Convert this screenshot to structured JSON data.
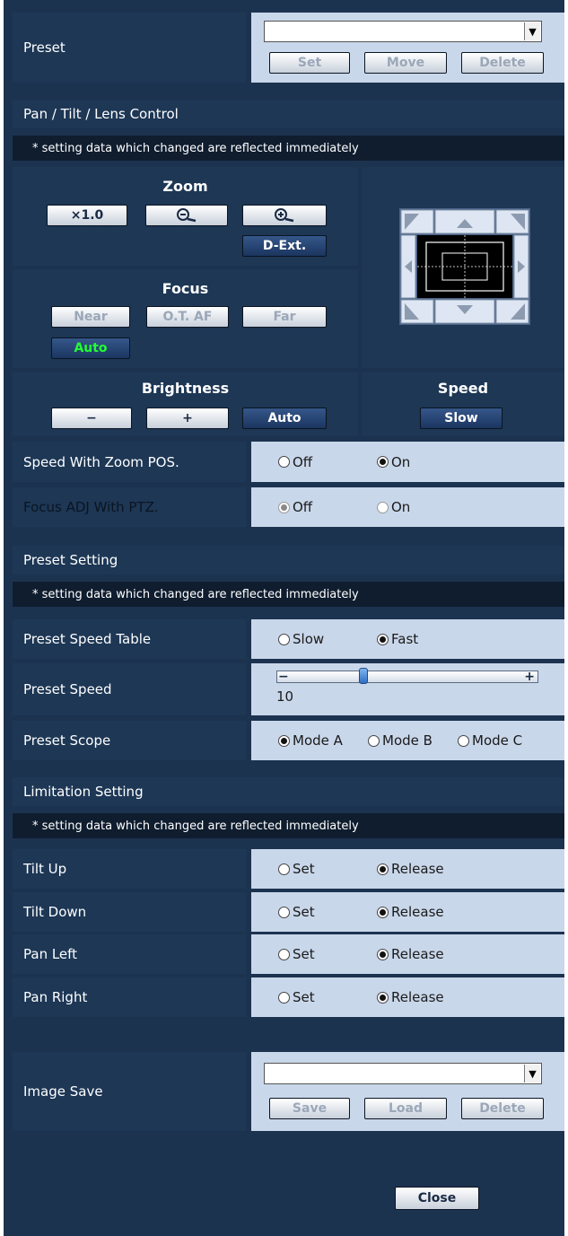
{
  "preset": {
    "label": "Preset",
    "select_value": "",
    "buttons": {
      "set": "Set",
      "move": "Move",
      "delete": "Delete"
    }
  },
  "ptl": {
    "title": "Pan / Tilt / Lens Control",
    "note": "* setting data which changed are reflected immediately",
    "zoom": {
      "title": "Zoom",
      "x1": "×1.0",
      "dext": "D-Ext."
    },
    "focus": {
      "title": "Focus",
      "near": "Near",
      "otaf": "O.T. AF",
      "far": "Far",
      "auto": "Auto"
    },
    "brightness": {
      "title": "Brightness",
      "minus": "−",
      "plus": "+",
      "auto": "Auto"
    },
    "speed": {
      "title": "Speed",
      "value": "Slow"
    },
    "speed_zoom": {
      "label": "Speed With Zoom POS.",
      "off": "Off",
      "on": "On",
      "selected": "On"
    },
    "focus_adj": {
      "label": "Focus ADJ With PTZ.",
      "off": "Off",
      "on": "On",
      "selected": "Off"
    }
  },
  "preset_setting": {
    "title": "Preset Setting",
    "note": "* setting data which changed are reflected immediately",
    "speed_table": {
      "label": "Preset Speed Table",
      "slow": "Slow",
      "fast": "Fast",
      "selected": "Fast"
    },
    "speed": {
      "label": "Preset Speed",
      "value": "10",
      "minus": "−",
      "plus": "+",
      "level": 0.3
    },
    "scope": {
      "label": "Preset Scope",
      "a": "Mode A",
      "b": "Mode B",
      "c": "Mode C",
      "selected": "Mode A"
    }
  },
  "limitation": {
    "title": "Limitation Setting",
    "note": "* setting data which changed are reflected immediately",
    "rows": [
      {
        "label": "Tilt Up",
        "set": "Set",
        "release": "Release"
      },
      {
        "label": "Tilt Down",
        "set": "Set",
        "release": "Release"
      },
      {
        "label": "Pan Left",
        "set": "Set",
        "release": "Release"
      },
      {
        "label": "Pan Right",
        "set": "Set",
        "release": "Release"
      }
    ]
  },
  "image_save": {
    "label": "Image Save",
    "select_value": "",
    "buttons": {
      "save": "Save",
      "load": "Load",
      "delete": "Delete"
    }
  },
  "close": "Close",
  "colors": {
    "bg": "#1c3350",
    "label_bg": "#1d3755",
    "value_bg": "#c9d7ea",
    "note_bg": "#0f1d2f",
    "auto_green": "#22ff33"
  }
}
